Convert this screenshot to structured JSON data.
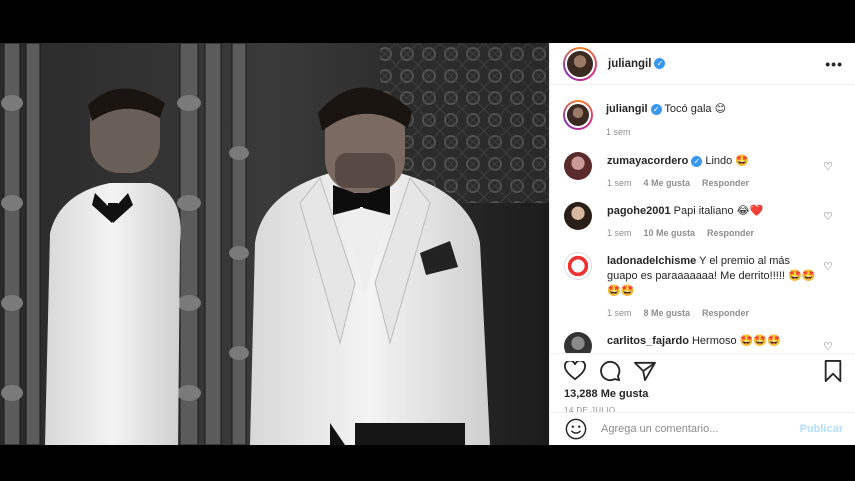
{
  "post": {
    "author": "juliangil",
    "more_label": "•••",
    "caption": {
      "username": "juliangil",
      "text": "Tocó gala 😊",
      "time": "1 sem"
    }
  },
  "comments": [
    {
      "username": "zumayacordero",
      "verified": true,
      "text": "Lindo 🤩",
      "time": "1 sem",
      "likes": "4 Me gusta",
      "reply": "Responder"
    },
    {
      "username": "pagohe2001",
      "verified": false,
      "text": "Papi italiano 😂❤️",
      "time": "1 sem",
      "likes": "10 Me gusta",
      "reply": "Responder"
    },
    {
      "username": "ladonadelchisme",
      "verified": false,
      "text": "Y el premio al más guapo es paraaaaaaa! Me derrito!!!!! 🤩🤩🤩🤩",
      "time": "1 sem",
      "likes": "8 Me gusta",
      "reply": "Responder"
    },
    {
      "username": "carlitos_fajardo",
      "verified": false,
      "text": "Hermoso 🤩🤩🤩",
      "time": "",
      "likes": "",
      "reply": ""
    }
  ],
  "icons": {
    "like": "heart-icon",
    "comment": "comment-icon",
    "share": "share-icon",
    "save": "bookmark-icon",
    "emoji": "emoji-icon"
  },
  "stats": {
    "likes": "13,288 Me gusta",
    "date": "14 DE JULIO"
  },
  "composer": {
    "placeholder": "Agrega un comentario...",
    "publish_label": "Publicar"
  },
  "colors": {
    "verified": "#3897f0",
    "publish": "#b2dffc",
    "muted": "#8e8e8e"
  }
}
